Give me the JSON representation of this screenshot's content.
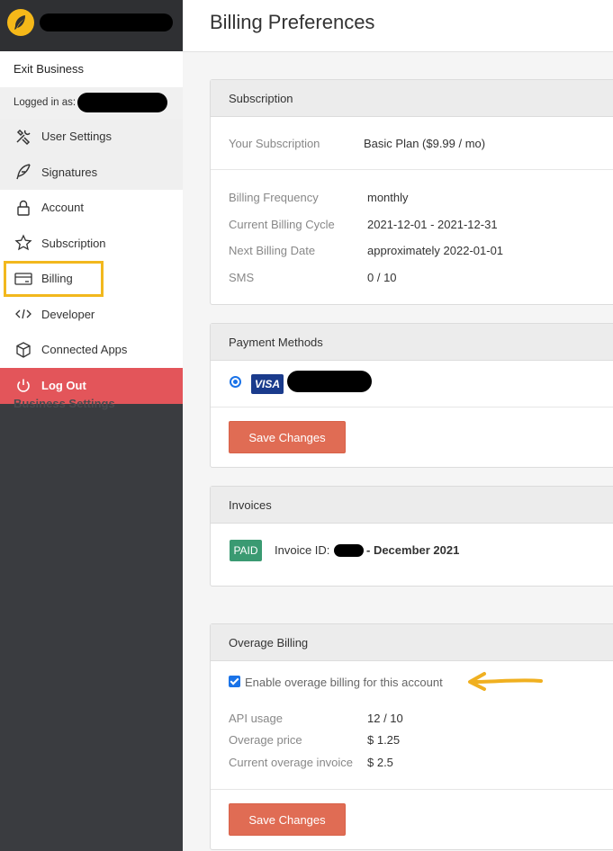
{
  "sidebar": {
    "exit_business": "Exit Business",
    "logged_in_label": "Logged in as:",
    "items": [
      {
        "label": "User Settings",
        "icon": "tools-icon"
      },
      {
        "label": "Signatures",
        "icon": "feather-icon"
      },
      {
        "label": "Account",
        "icon": "lock-icon"
      },
      {
        "label": "Subscription",
        "icon": "star-icon"
      },
      {
        "label": "Billing",
        "icon": "card-icon"
      },
      {
        "label": "Developer",
        "icon": "code-icon"
      },
      {
        "label": "Connected Apps",
        "icon": "box-icon"
      }
    ],
    "logout": "Log Out",
    "ghost_item": "Business Settings"
  },
  "header": {
    "title": "Billing Preferences"
  },
  "subscription": {
    "heading": "Subscription",
    "your_subscription_label": "Your Subscription",
    "your_subscription_value": "Basic Plan ($9.99 / mo)",
    "frequency_label": "Billing Frequency",
    "frequency_value": "monthly",
    "cycle_label": "Current Billing Cycle",
    "cycle_value": "2021-12-01 - 2021-12-31",
    "next_label": "Next Billing Date",
    "next_value": "approximately 2022-01-01",
    "sms_label": "SMS",
    "sms_value": "0 / 10"
  },
  "payment": {
    "heading": "Payment Methods",
    "card_brand": "VISA",
    "save_label": "Save Changes"
  },
  "invoices": {
    "heading": "Invoices",
    "status": "PAID",
    "invoice_label": "Invoice ID:",
    "invoice_month": "- December 2021"
  },
  "overage": {
    "heading": "Overage Billing",
    "enable_label": "Enable overage billing for this account",
    "api_label": "API usage",
    "api_value": "12 / 10",
    "price_label": "Overage price",
    "price_value": "$ 1.25",
    "current_label": "Current overage invoice",
    "current_value": "$ 2.5",
    "save_label": "Save Changes"
  },
  "colors": {
    "accent": "#e06c54",
    "logout": "#e3555a",
    "highlight": "#f2b81d",
    "paid": "#3a9a72"
  }
}
